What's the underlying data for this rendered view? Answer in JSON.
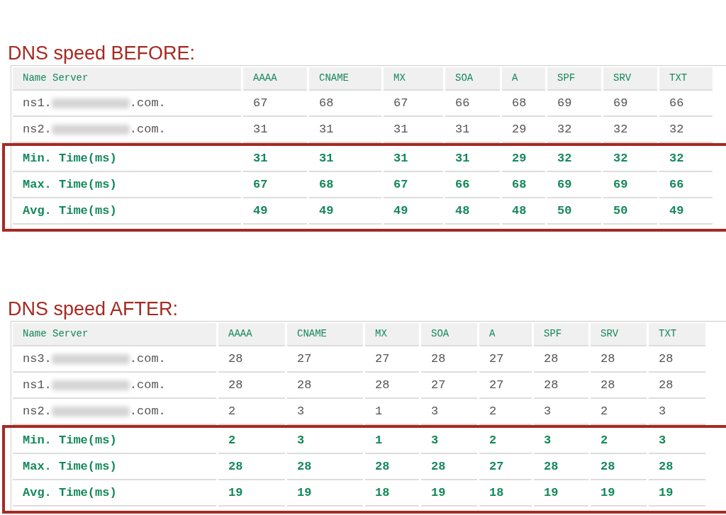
{
  "sections": [
    {
      "title": "DNS speed BEFORE:",
      "columns": [
        "Name Server",
        "AAAA",
        "CNAME",
        "MX",
        "SOA",
        "A",
        "SPF",
        "SRV",
        "TXT"
      ],
      "rows": [
        {
          "kind": "server",
          "prefix": "ns1.",
          "suffix": ".com.",
          "values": [
            "67",
            "68",
            "67",
            "66",
            "68",
            "69",
            "69",
            "66"
          ]
        },
        {
          "kind": "server",
          "prefix": "ns2.",
          "suffix": ".com.",
          "values": [
            "31",
            "31",
            "31",
            "31",
            "29",
            "32",
            "32",
            "32"
          ]
        },
        {
          "kind": "summary",
          "label": "Min. Time(ms)",
          "values": [
            "31",
            "31",
            "31",
            "31",
            "29",
            "32",
            "32",
            "32"
          ]
        },
        {
          "kind": "summary",
          "label": "Max. Time(ms)",
          "values": [
            "67",
            "68",
            "67",
            "66",
            "68",
            "69",
            "69",
            "66"
          ]
        },
        {
          "kind": "summary",
          "label": "Avg. Time(ms)",
          "values": [
            "49",
            "49",
            "49",
            "48",
            "48",
            "50",
            "50",
            "49"
          ]
        }
      ]
    },
    {
      "title": "DNS speed AFTER:",
      "columns": [
        "Name Server",
        "AAAA",
        "CNAME",
        "MX",
        "SOA",
        "A",
        "SPF",
        "SRV",
        "TXT"
      ],
      "rows": [
        {
          "kind": "server",
          "prefix": "ns3.",
          "suffix": ".com.",
          "values": [
            "28",
            "27",
            "27",
            "28",
            "27",
            "28",
            "28",
            "28"
          ]
        },
        {
          "kind": "server",
          "prefix": "ns1.",
          "suffix": ".com.",
          "values": [
            "28",
            "28",
            "28",
            "27",
            "27",
            "28",
            "28",
            "28"
          ]
        },
        {
          "kind": "server",
          "prefix": "ns2.",
          "suffix": ".com.",
          "values": [
            "2",
            "3",
            "1",
            "3",
            "2",
            "3",
            "2",
            "3"
          ]
        },
        {
          "kind": "summary",
          "label": "Min. Time(ms)",
          "values": [
            "2",
            "3",
            "1",
            "3",
            "2",
            "3",
            "2",
            "3"
          ]
        },
        {
          "kind": "summary",
          "label": "Max. Time(ms)",
          "values": [
            "28",
            "28",
            "28",
            "28",
            "27",
            "28",
            "28",
            "28"
          ]
        },
        {
          "kind": "summary",
          "label": "Avg. Time(ms)",
          "values": [
            "19",
            "19",
            "18",
            "19",
            "18",
            "19",
            "19",
            "19"
          ]
        }
      ]
    }
  ]
}
